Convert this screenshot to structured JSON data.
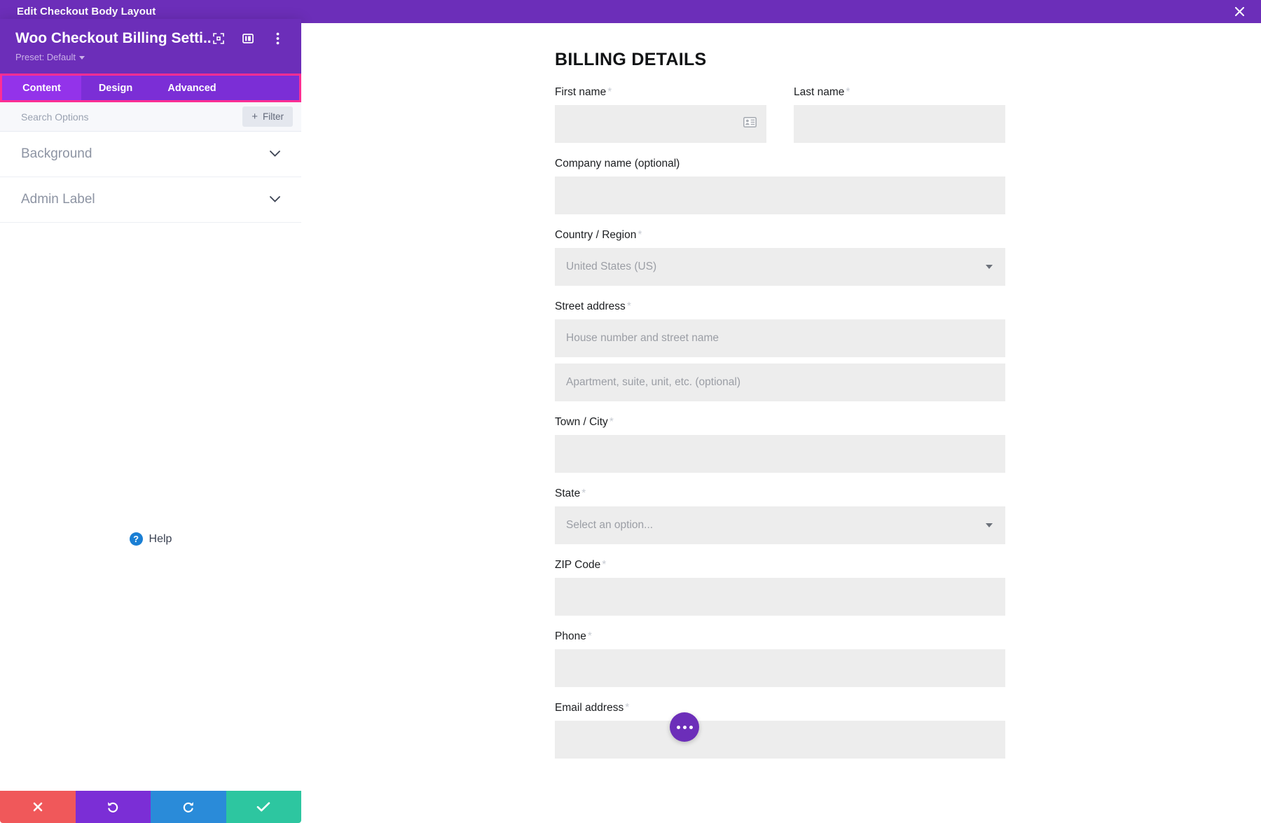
{
  "topbar": {
    "title": "Edit Checkout Body Layout",
    "close_icon": "close-icon"
  },
  "panel": {
    "module_title": "Woo Checkout Billing Setti...",
    "preset_label": "Preset: Default",
    "header_icons": [
      {
        "name": "focus-target-icon"
      },
      {
        "name": "panel-layout-icon"
      },
      {
        "name": "more-vertical-icon"
      }
    ],
    "tabs": [
      {
        "label": "Content",
        "active": true
      },
      {
        "label": "Design",
        "active": false
      },
      {
        "label": "Advanced",
        "active": false
      }
    ],
    "search": {
      "placeholder": "Search Options",
      "value": ""
    },
    "filter_button": {
      "label": "Filter",
      "plus": "+"
    },
    "sections": [
      {
        "label": "Background",
        "chevron": "chevron-down-icon"
      },
      {
        "label": "Admin Label",
        "chevron": "chevron-down-icon"
      }
    ],
    "help": {
      "label": "Help",
      "badge": "?"
    },
    "actions": [
      {
        "name": "cancel-button",
        "glyph": "✖",
        "color": "#f0585a"
      },
      {
        "name": "undo-button",
        "glyph": "↺",
        "color": "#7b2ed6"
      },
      {
        "name": "redo-button",
        "glyph": "↻",
        "color": "#2a8bd9"
      },
      {
        "name": "save-button",
        "glyph": "✔",
        "color": "#2dc6a0"
      }
    ]
  },
  "checkout": {
    "heading": "BILLING DETAILS",
    "required_mark": "*",
    "fields": {
      "first_name": {
        "label": "First name",
        "value": "",
        "placeholder": ""
      },
      "last_name": {
        "label": "Last name",
        "value": "",
        "placeholder": ""
      },
      "company_name": {
        "label": "Company name (optional)",
        "value": "",
        "placeholder": ""
      },
      "country_region": {
        "label": "Country / Region",
        "value": "United States (US)"
      },
      "street_address": {
        "label": "Street address",
        "placeholder": "House number and street name"
      },
      "address_line_2": {
        "label": "",
        "placeholder": "Apartment, suite, unit, etc. (optional)"
      },
      "town_city": {
        "label": "Town / City",
        "value": "",
        "placeholder": ""
      },
      "state": {
        "label": "State",
        "value": "Select an option..."
      },
      "zip_code": {
        "label": "ZIP Code",
        "value": "",
        "placeholder": ""
      },
      "phone": {
        "label": "Phone",
        "value": "",
        "placeholder": ""
      },
      "email_address": {
        "label": "Email address",
        "value": "",
        "placeholder": ""
      }
    },
    "fab": {
      "name": "add-module-button",
      "glyph": "..."
    }
  },
  "colors": {
    "brand_purple": "#6c2eb9",
    "tab_purple": "#7b2ed6",
    "tab_active": "#9333ea",
    "highlight_pink": "#ff2e93",
    "input_gray": "#ededed"
  }
}
